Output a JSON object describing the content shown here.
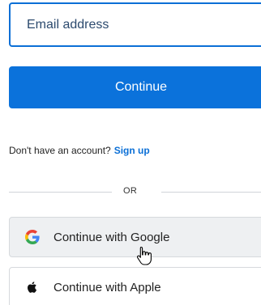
{
  "login": {
    "email_placeholder": "Email address",
    "continue_label": "Continue",
    "signup_prompt": "Don't have an account?",
    "signup_link": "Sign up",
    "divider_text": "OR",
    "social": [
      {
        "label": "Continue with Google",
        "icon": "google-icon"
      },
      {
        "label": "Continue with Apple",
        "icon": "apple-icon"
      }
    ]
  },
  "colors": {
    "primary": "#0b72db",
    "link": "#0b6fd6",
    "divider": "#d0d4d9"
  }
}
